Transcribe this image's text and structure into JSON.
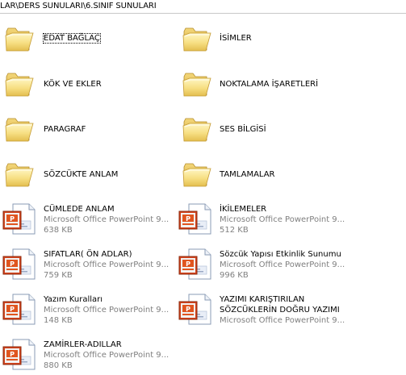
{
  "address_bar": {
    "path": "LAR\\DERS SUNULARI\\6.SINIF SUNULARI"
  },
  "folders": [
    {
      "name": "EDAT BAĞLAÇ"
    },
    {
      "name": "İSİMLER"
    },
    {
      "name": "KÖK VE EKLER"
    },
    {
      "name": "NOKTALAMA İŞARETLERİ"
    },
    {
      "name": "PARAGRAF"
    },
    {
      "name": "SES BİLGİSİ"
    },
    {
      "name": "SÖZCÜKTE ANLAM"
    },
    {
      "name": "TAMLAMALAR"
    }
  ],
  "files": [
    {
      "name": "CÜMLEDE ANLAM",
      "type": "Microsoft Office PowerPoint 9...",
      "size": "638 KB"
    },
    {
      "name": "İKİLEMELER",
      "type": "Microsoft Office PowerPoint 9...",
      "size": "512 KB"
    },
    {
      "name": "SIFATLAR( ÖN ADLAR)",
      "type": "Microsoft Office PowerPoint 9...",
      "size": "759 KB"
    },
    {
      "name": "Sözcük Yapısı Etkinlik Sunumu",
      "type": "Microsoft Office PowerPoint 9...",
      "size": "996 KB"
    },
    {
      "name": "Yazım Kuralları",
      "type": "Microsoft Office PowerPoint 9...",
      "size": "148 KB"
    },
    {
      "name_line1": "YAZIMI KARIŞTIRILAN",
      "name_line2": "SÖZCÜKLERİN DOĞRU YAZIMI",
      "type": "Microsoft Office PowerPoint 9..."
    },
    {
      "name": "ZAMİRLER-ADILLAR",
      "type": "Microsoft Office PowerPoint 9...",
      "size": "880 KB"
    }
  ]
}
